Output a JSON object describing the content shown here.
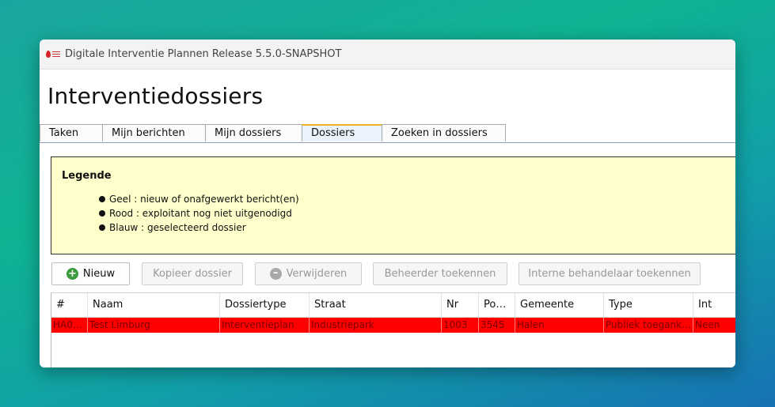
{
  "window": {
    "title": "Digitale Interventie Plannen Release 5.5.0-SNAPSHOT"
  },
  "page": {
    "title": "Interventiedossiers"
  },
  "tabs": [
    "Taken",
    "Mijn berichten",
    "Mijn dossiers",
    "Dossiers",
    "Zoeken in dossiers"
  ],
  "active_tab": "Dossiers",
  "legend": {
    "title": "Legende",
    "items": [
      "Geel : nieuw of onafgewerkt bericht(en)",
      "Rood : exploitant nog niet uitgenodigd",
      "Blauw : geselecteerd dossier"
    ]
  },
  "toolbar": {
    "new_label": "Nieuw",
    "copy_label": "Kopieer dossier",
    "delete_label": "Verwijderen",
    "assign_manager_label": "Beheerder toekennen",
    "assign_internal_label": "Interne behandelaar toekennen"
  },
  "table": {
    "columns": [
      "#",
      "Naam",
      "Dossiertype",
      "Straat",
      "Nr",
      "Po…",
      "Gemeente",
      "Type",
      "Int"
    ],
    "rows": [
      [
        "HA0…",
        "Test Limburg",
        "Interventieplan",
        "Industriepark",
        "1003",
        "3545",
        "Halen",
        "Publiek toegank…",
        "Neen"
      ]
    ]
  },
  "colors": {
    "row_highlight": "#ff0000",
    "legend_bg": "#ffffcc",
    "active_tab_accent": "#f0b028"
  }
}
